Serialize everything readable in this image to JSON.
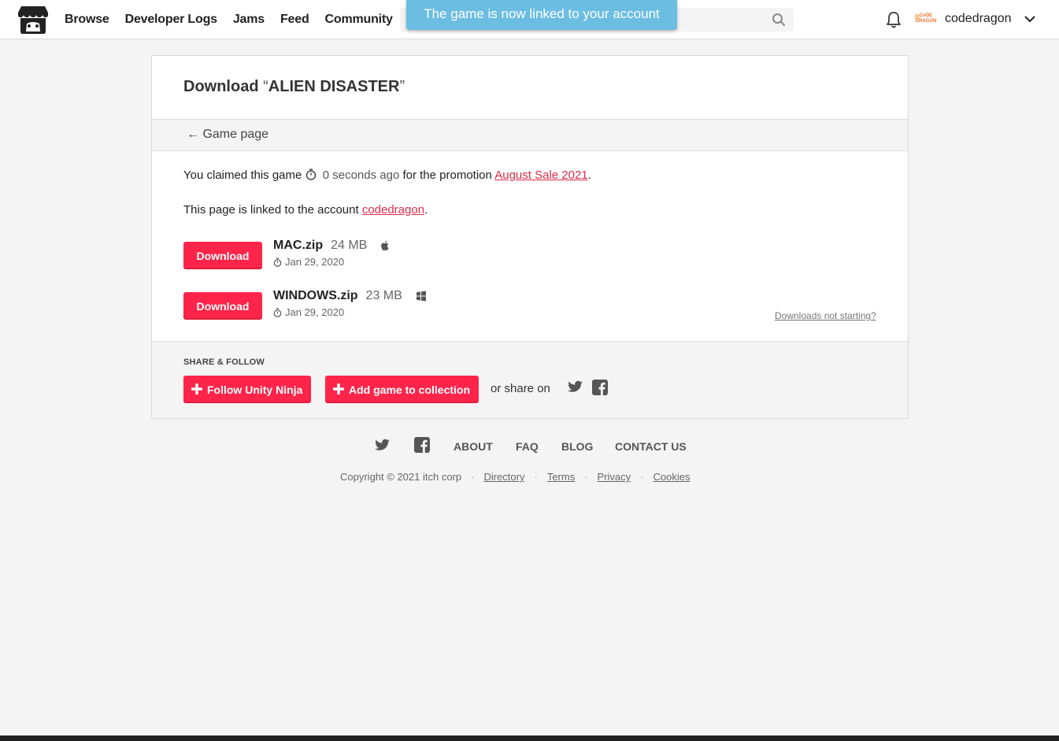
{
  "header": {
    "nav": [
      "Browse",
      "Developer Logs",
      "Jams",
      "Feed",
      "Community"
    ],
    "search_placeholder": "",
    "toast": "The game is now linked to your account",
    "username": "codedragon",
    "avatar_text": "Code Dragon"
  },
  "page": {
    "title_prefix": "Download",
    "quote_open": "“",
    "game_name": "ALIEN DISASTER",
    "quote_close": "”",
    "back_arrow": "←",
    "back_label": "Game page",
    "claimed_prefix": "You claimed this game",
    "claimed_time": "0 seconds ago",
    "claimed_middle": "for the promotion",
    "promotion": "August Sale 2021",
    "period": ".",
    "linked_prefix": "This page is linked to the account",
    "linked_account": "codedragon",
    "uploads": [
      {
        "button": "Download",
        "name": "MAC.zip",
        "size": "24 MB",
        "date": "Jan 29, 2020",
        "os_icon": "apple-icon"
      },
      {
        "button": "Download",
        "name": "WINDOWS.zip",
        "size": "23 MB",
        "date": "Jan 29, 2020",
        "os_icon": "windows-icon"
      }
    ],
    "not_starting": "Downloads not starting?"
  },
  "share": {
    "label": "SHARE & FOLLOW",
    "follow_button": "Follow Unity Ninja",
    "collection_button": "Add game to collection",
    "or_share": "or share on"
  },
  "footer": {
    "links": [
      "ABOUT",
      "FAQ",
      "BLOG",
      "CONTACT US"
    ],
    "copyright": "Copyright © 2021 itch corp",
    "legal": [
      "Directory",
      "Terms",
      "Privacy",
      "Cookies"
    ],
    "separator": "·"
  },
  "colors": {
    "accent": "#ff2449",
    "link": "#da2c49",
    "toast": "#6bbde2"
  }
}
